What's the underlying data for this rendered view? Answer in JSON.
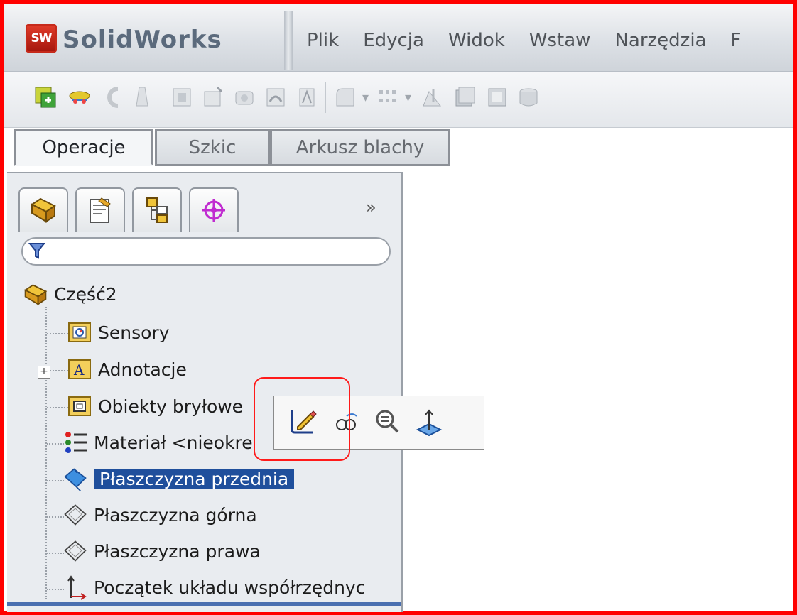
{
  "app": {
    "logo_badge": "SW",
    "logo_name": "SolidWorks"
  },
  "menu": [
    "Plik",
    "Edycja",
    "Widok",
    "Wstaw",
    "Narzędzia",
    "F"
  ],
  "tabs": [
    {
      "label": "Operacje",
      "active": true
    },
    {
      "label": "Szkic",
      "active": false
    },
    {
      "label": "Arkusz blachy",
      "active": false
    }
  ],
  "panel": {
    "tab_icons": [
      "feature-manager-icon",
      "property-manager-icon",
      "configuration-manager-icon",
      "dimxpert-icon"
    ],
    "expand_label": "»",
    "filter_icon": "filter-icon"
  },
  "tree": {
    "root": "Część2",
    "items": [
      {
        "label": "Sensory",
        "icon": "sensor-folder-icon"
      },
      {
        "label": "Adnotacje",
        "icon": "annotations-folder-icon"
      },
      {
        "label": "Obiekty bryłowe",
        "icon": "solid-bodies-folder-icon"
      },
      {
        "label": "Materiał <nieokre",
        "icon": "material-icon"
      },
      {
        "label": "Płaszczyzna przednia",
        "icon": "plane-icon",
        "selected": true
      },
      {
        "label": "Płaszczyzna górna",
        "icon": "plane-icon"
      },
      {
        "label": "Płaszczyzna prawa",
        "icon": "plane-icon"
      },
      {
        "label": "Początek układu współrzędnyc",
        "icon": "origin-icon"
      }
    ],
    "expander": "+"
  },
  "context_toolbar": [
    "edit-sketch-icon",
    "hide-show-icon",
    "zoom-to-selection-icon",
    "normal-to-icon"
  ],
  "colors": {
    "frame": "#ff0000",
    "selection": "#1f4f9c",
    "highlight": "#ff1a1a"
  }
}
